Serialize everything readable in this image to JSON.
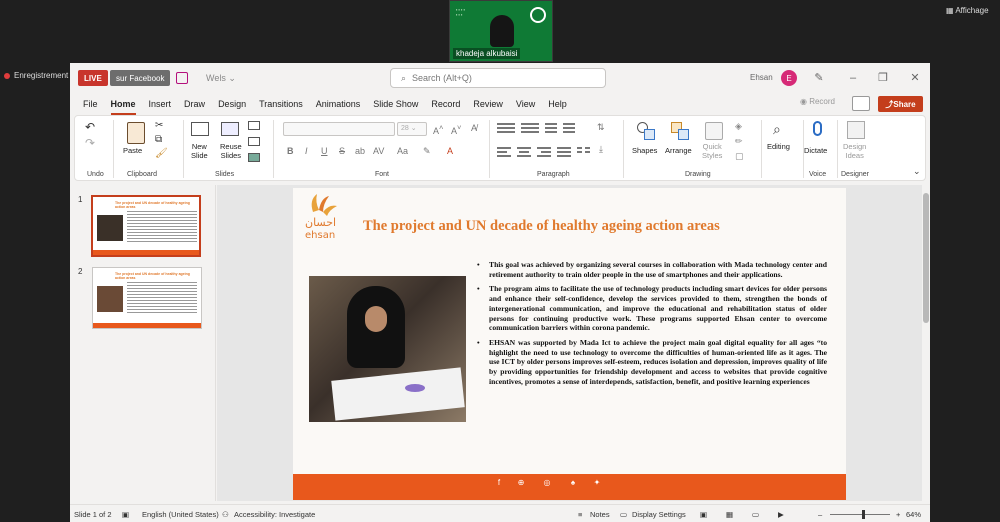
{
  "overlay": {
    "video_tile_name": "khadeja alkubaisi",
    "view_label": "Affichage",
    "recording_label": "Enregistrement"
  },
  "titlebar": {
    "live_label": "LIVE",
    "live_target": "sur Facebook",
    "doc_name": "Wels",
    "search_placeholder": "Search (Alt+Q)",
    "user_name": "Ehsan",
    "user_initial": "E"
  },
  "menu": {
    "items": [
      "File",
      "Home",
      "Insert",
      "Draw",
      "Design",
      "Transitions",
      "Animations",
      "Slide Show",
      "Record",
      "Review",
      "View",
      "Help"
    ],
    "record_label": "Record",
    "share_label": "Share"
  },
  "ribbon": {
    "undo_group": "Undo",
    "clipboard_group": "Clipboard",
    "paste_label": "Paste",
    "slides_group": "Slides",
    "new_slide_label": "New",
    "new_slide_label2": "Slide",
    "reuse_slides_label": "Reuse",
    "reuse_slides_label2": "Slides",
    "font_group": "Font",
    "font_size": "28",
    "paragraph_group": "Paragraph",
    "drawing_group": "Drawing",
    "shapes_label": "Shapes",
    "arrange_label": "Arrange",
    "quick_styles_label": "Quick",
    "quick_styles_label2": "Styles",
    "editing_label": "Editing",
    "voice_group": "Voice",
    "dictate_label": "Dictate",
    "designer_group": "Designer",
    "design_ideas_label": "Design",
    "design_ideas_label2": "Ideas"
  },
  "thumbnails": [
    {
      "number": "1",
      "title": "The project and UN decade of healthy ageing action areas"
    },
    {
      "number": "2",
      "title": "The project and UN decade of healthy ageing action areas"
    }
  ],
  "slide": {
    "title": "The project and UN decade of healthy ageing action areas",
    "logo_text": "ehsan",
    "logo_arabic": "احسان",
    "bullets": [
      "This goal was achieved by organizing several courses in collaboration with Mada technology center and retirement authority to train older people in the use of smartphones and their applications.",
      "The program aims to facilitate the use of technology products including smart devices for older persons and enhance their self-confidence, develop the services provided to them, strengthen the bonds of intergenerational communication, and improve the educational and rehabilitation status of older persons for continuing productive work. These programs supported Ehsan center to overcome communication barriers within corona pandemic.",
      "EHSAN was supported by Mada Ict to achieve the project main goal digital equality for all ages “to highlight the need to use technology to overcome the difficulties of human-oriented life as it ages. The use ICT by older persons improves self-esteem, reduces isolation and depression, improves quality of life by providing opportunities for friendship development and access to websites that provide cognitive incentives, promotes a sense of interdepends, satisfaction, benefit, and positive learning experiences"
    ],
    "footer_icons": [
      "facebook-icon",
      "web-icon",
      "instagram-icon",
      "snapchat-icon",
      "twitter-icon"
    ]
  },
  "statusbar": {
    "slide_indicator": "Slide 1 of 2",
    "language": "English (United States)",
    "accessibility": "Accessibility: Investigate",
    "notes_label": "Notes",
    "display_settings_label": "Display Settings",
    "zoom_level": "64%"
  },
  "colors": {
    "accent": "#c43e1c",
    "slide_title": "#e07a2e",
    "footer": "#e8581c",
    "live": "#c8352c"
  }
}
